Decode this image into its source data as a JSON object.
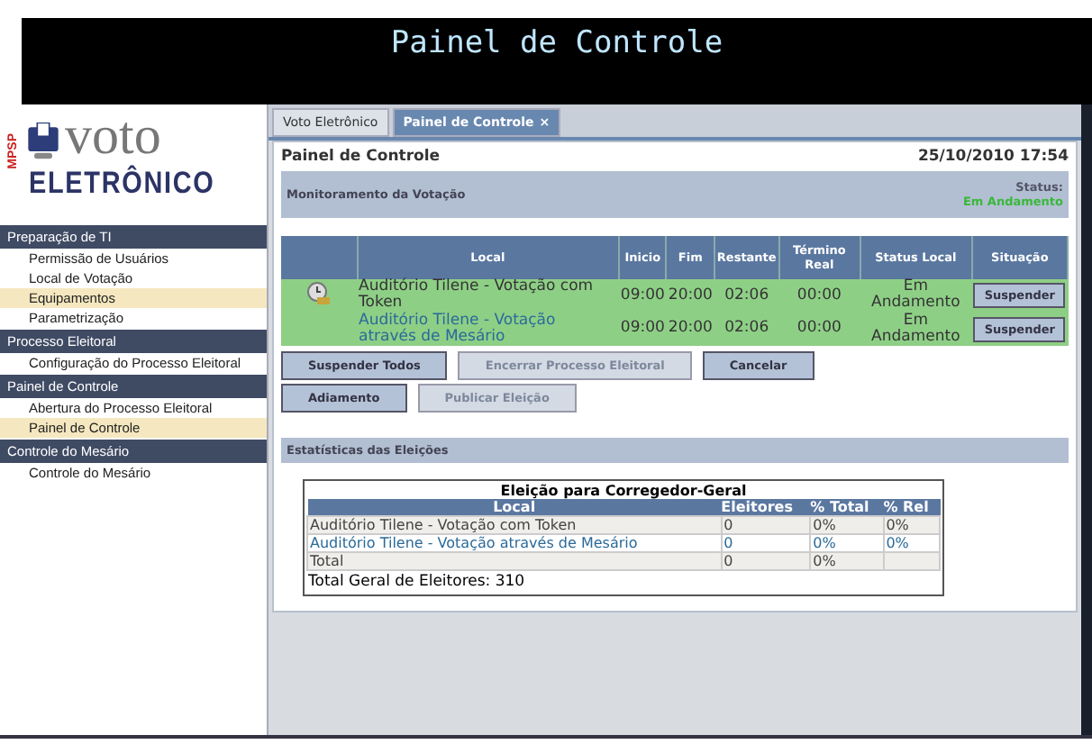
{
  "header": {
    "title": "Painel de Controle"
  },
  "logo": {
    "vertical": "MPSP",
    "word": "voto",
    "subtitle": "ELETRÔNICO"
  },
  "sidebar": {
    "sections": [
      {
        "title": "Preparação de TI",
        "items": [
          {
            "label": "Permissão de Usuários",
            "selected": false
          },
          {
            "label": "Local de Votação",
            "selected": false
          },
          {
            "label": "Equipamentos",
            "selected": true
          },
          {
            "label": "Parametrização",
            "selected": false
          }
        ]
      },
      {
        "title": "Processo Eleitoral",
        "items": [
          {
            "label": "Configuração do Processo Eleitoral",
            "selected": false
          }
        ]
      },
      {
        "title": "Painel de Controle",
        "items": [
          {
            "label": "Abertura do Processo Eleitoral",
            "selected": false
          },
          {
            "label": "Painel de Controle",
            "selected": true
          }
        ]
      },
      {
        "title": "Controle do Mesário",
        "items": [
          {
            "label": "Controle do Mesário",
            "selected": false
          }
        ]
      }
    ]
  },
  "tabs": [
    {
      "label": "Voto Eletrônico",
      "selected": false
    },
    {
      "label": "Painel de Controle",
      "selected": true,
      "close": "×"
    }
  ],
  "page": {
    "title": "Painel de Controle",
    "datetime": "25/10/2010 17:54"
  },
  "monitor": {
    "title": "Monitoramento da Votação",
    "status_label": "Status:",
    "status_value": "Em Andamento",
    "columns": [
      "Local",
      "Inicio",
      "Fim",
      "Restante",
      "Término Real",
      "Status Local",
      "Situação"
    ],
    "rows": [
      {
        "icon": true,
        "highlighted": false,
        "local": "Auditório Tilene - Votação com Token",
        "inicio": "09:00",
        "fim": "20:00",
        "restante": "02:06",
        "termino": "00:00",
        "status": "Em Andamento",
        "action": "Suspender"
      },
      {
        "icon": false,
        "highlighted": true,
        "local": "Auditório Tilene - Votação através de Mesário",
        "inicio": "09:00",
        "fim": "20:00",
        "restante": "02:06",
        "termino": "00:00",
        "status": "Em Andamento",
        "action": "Suspender"
      }
    ]
  },
  "buttons": [
    [
      {
        "label": "Suspender Todos",
        "disabled": false
      },
      {
        "label": "Encerrar Processo Eleitoral",
        "disabled": true
      },
      {
        "label": "Cancelar",
        "disabled": false
      }
    ],
    [
      {
        "label": "Adiamento",
        "disabled": false
      },
      {
        "label": "Publicar Eleição",
        "disabled": true
      }
    ]
  ],
  "stats": {
    "title": "Estatísticas das Eleições",
    "table_title": "Eleição para Corregedor-Geral",
    "columns": [
      "Local",
      "Eleitores",
      "% Total",
      "% Rel"
    ],
    "rows": [
      {
        "highlighted": false,
        "cells": [
          "Auditório Tilene - Votação com Token",
          "0",
          "0%",
          "0%"
        ]
      },
      {
        "highlighted": true,
        "cells": [
          "Auditório Tilene - Votação através de Mesário",
          "0",
          "0%",
          "0%"
        ]
      },
      {
        "highlighted": false,
        "cells": [
          "Total",
          "0",
          "0%"
        ]
      }
    ],
    "footer": "Total Geral de Eleitores: 310"
  }
}
